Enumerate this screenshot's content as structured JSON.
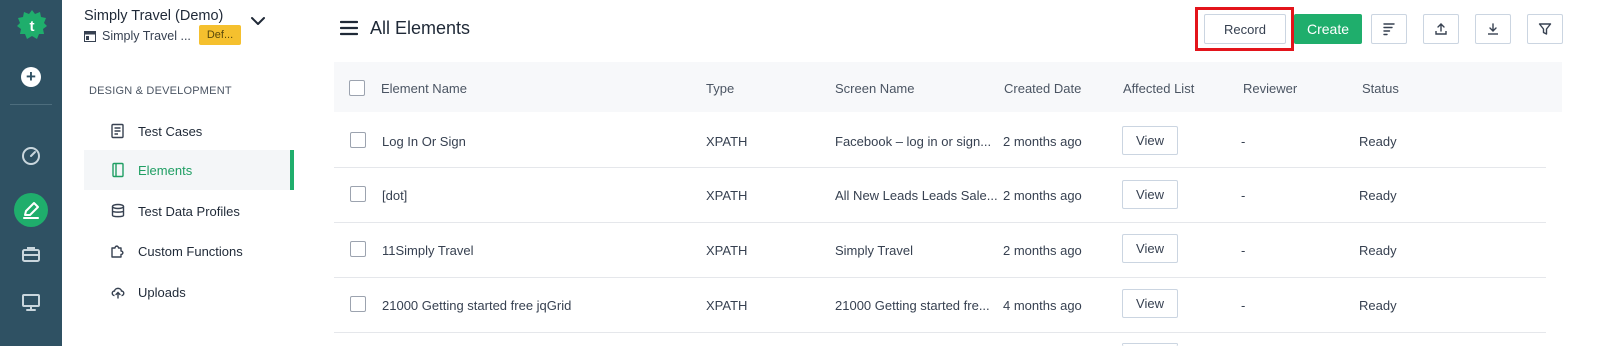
{
  "project": {
    "title": "Simply Travel (Demo)",
    "subtitle": "Simply Travel ...",
    "badge": "Def..."
  },
  "nav": {
    "section_title": "DESIGN & DEVELOPMENT",
    "items": [
      {
        "label": "Test Cases",
        "icon": "test-cases-icon"
      },
      {
        "label": "Elements",
        "icon": "elements-icon",
        "active": true
      },
      {
        "label": "Test Data Profiles",
        "icon": "database-icon"
      },
      {
        "label": "Custom Functions",
        "icon": "puzzle-icon"
      },
      {
        "label": "Uploads",
        "icon": "cloud-upload-icon"
      }
    ]
  },
  "page": {
    "title": "All Elements",
    "record_label": "Record",
    "create_label": "Create"
  },
  "table": {
    "columns": [
      "Element Name",
      "Type",
      "Screen Name",
      "Created Date",
      "Affected List",
      "Reviewer",
      "Status"
    ],
    "rows": [
      {
        "name": "Log In Or Sign",
        "type": "XPATH",
        "screen": "Facebook – log in or sign...",
        "created": "2 months ago",
        "affected": "View",
        "reviewer": "-",
        "status": "Ready"
      },
      {
        "name": "[dot]",
        "type": "XPATH",
        "screen": "All New Leads Leads Sale...",
        "created": "2 months ago",
        "affected": "View",
        "reviewer": "-",
        "status": "Ready"
      },
      {
        "name": "11Simply Travel",
        "type": "XPATH",
        "screen": "Simply Travel",
        "created": "2 months ago",
        "affected": "View",
        "reviewer": "-",
        "status": "Ready"
      },
      {
        "name": "21000 Getting started free jqGrid",
        "type": "XPATH",
        "screen": "21000 Getting started fre...",
        "created": "4 months ago",
        "affected": "View",
        "reviewer": "-",
        "status": "Ready"
      }
    ]
  },
  "colors": {
    "rail": "#2f5163",
    "accent": "#1fae6c",
    "badge": "#f5c02e",
    "highlight": "#e3141b"
  }
}
